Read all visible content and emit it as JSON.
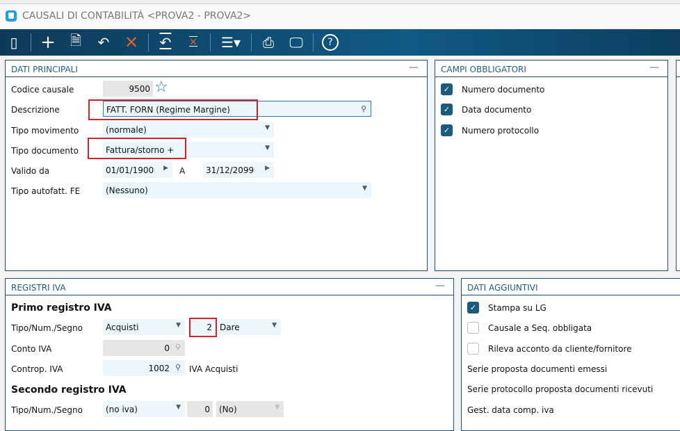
{
  "window": {
    "title": "CAUSALI DI CONTABILITÀ <PROVA2 - PROVA2>"
  },
  "toolbar": {
    "icons": [
      "panel-icon",
      "plus-icon",
      "document-icon",
      "undo-icon",
      "close-icon",
      "restore-icon",
      "delete-icon",
      "menu-icon",
      "print-icon",
      "monitor-icon",
      "help-icon"
    ]
  },
  "dati_principali": {
    "title": "DATI PRINCIPALI",
    "codice_label": "Codice causale",
    "codice_value": "9500",
    "descrizione_label": "Descrizione",
    "descrizione_value": "FATT. FORN  (Regime Margine)",
    "tipo_mov_label": "Tipo movimento",
    "tipo_mov_value": "(normale)",
    "tipo_doc_label": "Tipo documento",
    "tipo_doc_value": "Fattura/storno +",
    "valido_label": "Valido da",
    "valido_da": "01/01/1900",
    "a_label": "A",
    "valido_a": "31/12/2099",
    "autofatt_label": "Tipo autofatt. FE",
    "autofatt_value": "(Nessuno)"
  },
  "campi_obbligatori": {
    "title": "CAMPI OBBLIGATORI",
    "items": [
      {
        "label": "Numero documento",
        "checked": true
      },
      {
        "label": "Data documento",
        "checked": true
      },
      {
        "label": "Numero protocollo",
        "checked": true
      }
    ]
  },
  "registri_iva": {
    "title": "REGISTRI IVA",
    "primo_title": "Primo registro IVA",
    "tipo_label": "Tipo/Num./Segno",
    "tipo_value": "Acquisti",
    "num_value": "2",
    "segno_value": "Dare",
    "conto_label": "Conto IVA",
    "conto_value": "0",
    "controp_label": "Controp. IVA",
    "controp_value": "1002",
    "controp_desc": "IVA Acquisti",
    "secondo_title": "Secondo registro IVA",
    "tipo2_label": "Tipo/Num./Segno",
    "tipo2_value": "(no iva)",
    "num2_value": "0",
    "segno2_value": "(No)"
  },
  "dati_aggiuntivi": {
    "title": "DATI AGGIUNTIVI",
    "checks": [
      {
        "label": "Stampa  su LG",
        "checked": true
      },
      {
        "label": "Causale a Seq. obbligata",
        "checked": false
      },
      {
        "label": "Rileva acconto da cliente/fornitore",
        "checked": false
      }
    ],
    "labels": [
      "Serie proposta documenti emessi",
      "Serie protocollo proposta documenti ricevuti",
      "Gest. data comp. iva"
    ]
  }
}
